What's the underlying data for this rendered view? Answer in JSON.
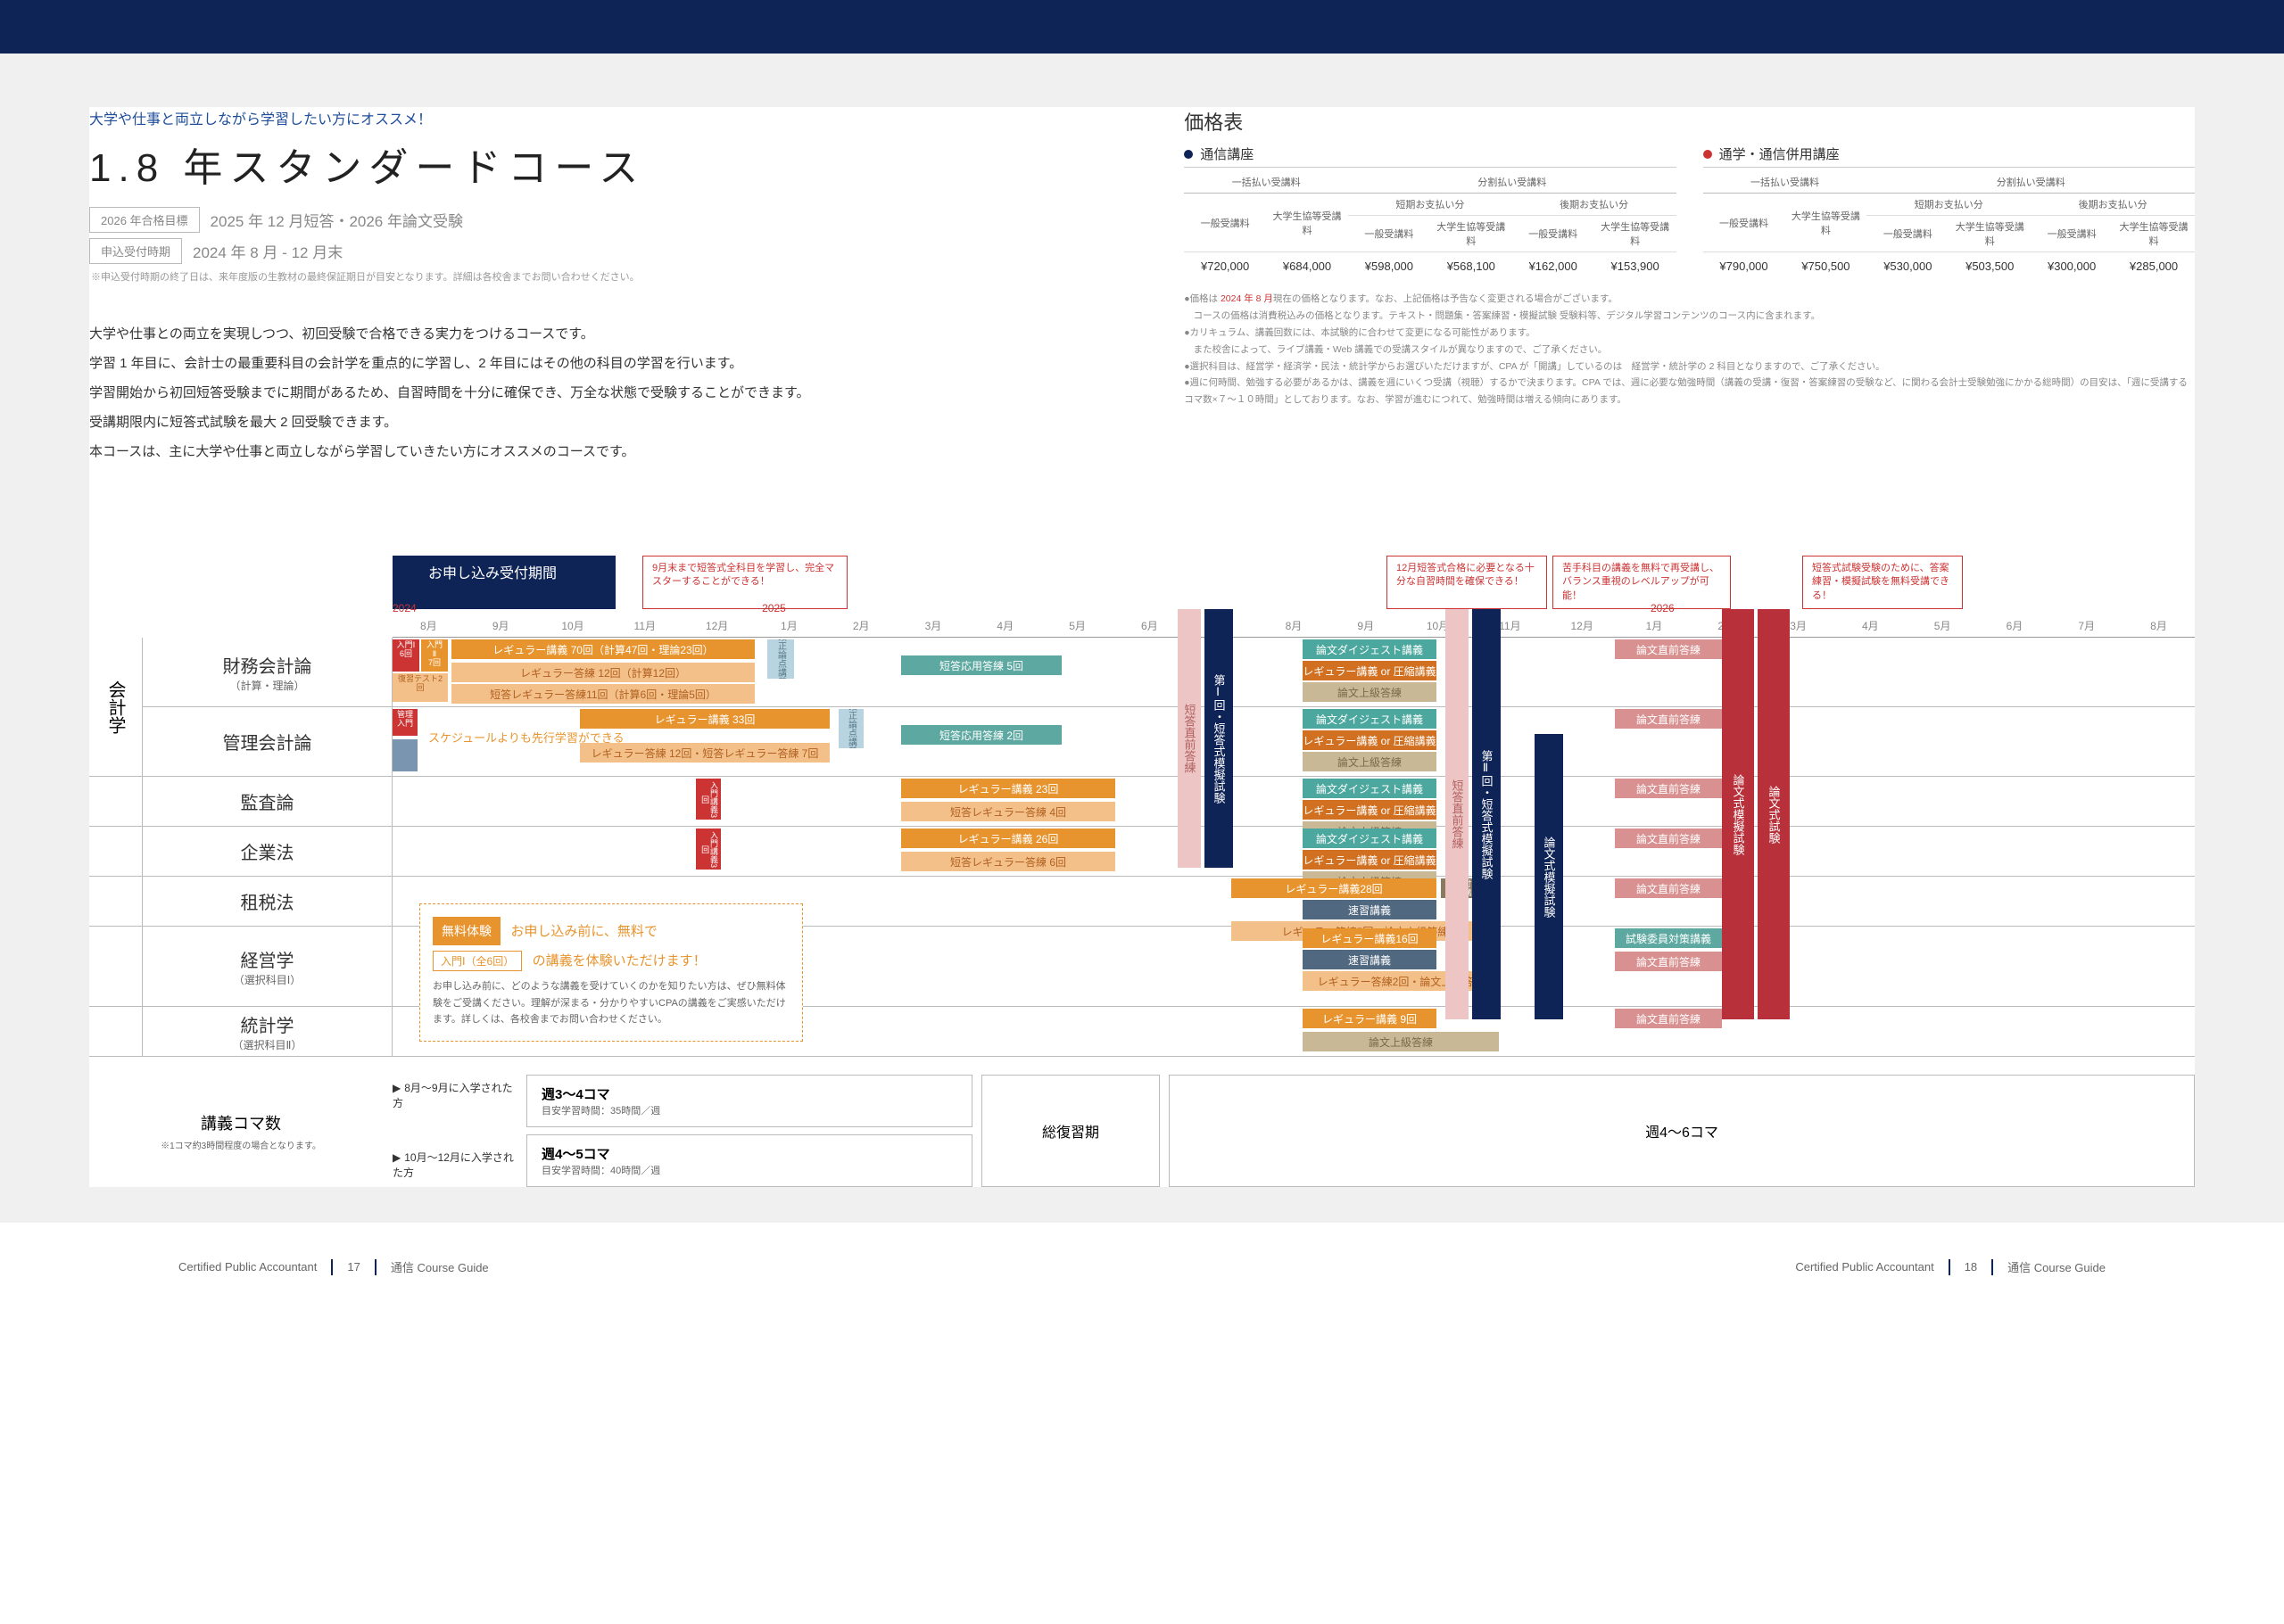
{
  "header": {
    "recommend": "大学や仕事と両立しながら学習したい方にオススメ！",
    "title": "1.8 年スタンダードコース",
    "tag1_label": "2026 年合格目標",
    "tag1_text": "2025 年 12 月短答・2026 年論文受験",
    "tag2_label": "申込受付時期",
    "tag2_text": "2024 年 8 月 - 12 月末",
    "tag2_note": "※申込受付時期の終了日は、来年度版の生教材の最終保証期日が目安となります。詳細は各校舎までお問い合わせください。"
  },
  "description": {
    "line1": "大学や仕事との両立を実現しつつ、初回受験で合格できる実力をつけるコースです。",
    "line2": "学習 1 年目に、会計士の最重要科目の会計学を重点的に学習し、2 年目にはその他の科目の学習を行います。",
    "line3": "学習開始から初回短答受験までに期間があるため、自習時間を十分に確保でき、万全な状態で受験することができます。",
    "line4": "受講期限内に短答式試験を最大 2 回受験できます。",
    "line5": "本コースは、主に大学や仕事と両立しながら学習していきたい方にオススメのコースです。"
  },
  "price": {
    "title": "価格表",
    "group1_title": "通信講座",
    "group2_title": "通学・通信併用講座",
    "col_lump": "一括払い受講料",
    "col_short": "短期お支払い分",
    "col_late": "後期お支払い分",
    "col_split": "分割払い受講料",
    "sub_general": "一般受講料",
    "sub_student": "大学生協等受講料",
    "g1": {
      "lump_general": "¥720,000",
      "lump_student": "¥684,000",
      "short_general": "¥598,000",
      "short_student": "¥568,100",
      "late_general": "¥162,000",
      "late_student": "¥153,900"
    },
    "g2": {
      "lump_general": "¥790,000",
      "lump_student": "¥750,500",
      "short_general": "¥530,000",
      "short_student": "¥503,500",
      "late_general": "¥300,000",
      "late_student": "¥285,000"
    },
    "notes": {
      "n1_pre": "●価格は ",
      "n1_hl": "2024 年 8 月",
      "n1_post": "現在の価格となります。なお、上記価格は予告なく変更される場合がございます。",
      "n2": "　コースの価格は消費税込みの価格となります。テキスト・問題集・答案練習・模擬試験 受験料等、デジタル学習コンテンツのコース内に含まれます。",
      "n3": "●カリキュラム、講義回数には、本試験的に合わせて変更になる可能性があります。",
      "n4": "　また校舎によって、ライブ講義・Web 講義での受講スタイルが異なりますので、ご了承ください。",
      "n5": "●選択科目は、経営学・経済学・民法・統計学からお選びいただけますが、CPA が「開講」しているのは　経営学・統計学の 2 科目となりますので、ご了承ください。",
      "n6": "●週に何時間、勉強する必要があるかは、講義を週にいくつ受講（視聴）するかで決まります。CPA では、週に必要な勉強時間（講義の受講・復習・答案練習の受験など、に関わる会計士受験勉強にかかる総時間）の目安は、「週に受講するコマ数×７～１０時間」としております。なお、学習が進むにつれて、勉強時間は増える傾向にあります。"
    }
  },
  "timeline": {
    "year1": "2024",
    "year2": "2025",
    "year3": "2026",
    "months": [
      "8月",
      "9月",
      "10月",
      "11月",
      "12月",
      "1月",
      "2月",
      "3月",
      "4月",
      "5月",
      "6月",
      "7月",
      "8月",
      "9月",
      "10月",
      "11月",
      "12月",
      "1月",
      "2月",
      "3月",
      "4月",
      "5月",
      "6月",
      "7月",
      "8月"
    ]
  },
  "callouts": {
    "apply": "お申し込み受付期間",
    "c1": "9月末まで短答式全科目を学習し、完全マスターすることができる！",
    "c2": "12月短答式合格に必要となる十分な自習時間を確保できる！",
    "c3": "苦手科目の講義を無料で再受講し、バランス重視のレベルアップが可能！",
    "c4": "短答式試験受験のために、答案練習・模擬試験を無料受講できる！"
  },
  "subjects": {
    "category": "会計学",
    "s1": "財務会計論",
    "s1_sub": "（計算・理論）",
    "s2": "管理会計論",
    "s3": "監査論",
    "s4": "企業法",
    "s5": "租税法",
    "s6": "経営学",
    "s6_sub": "（選択科目Ⅰ）",
    "s7": "統計学",
    "s7_sub": "（選択科目Ⅱ）"
  },
  "bars": {
    "intro1a": "入門Ⅰ",
    "intro1b": "6回",
    "intro2a": "入門Ⅱ",
    "intro2b": "7回",
    "test": "復習テスト2回",
    "reg70": "レギュラー講義 70回（計算47回・理論23回）",
    "reg12": "レギュラー答練 12回（計算12回）",
    "reg11": "短答レギュラー答練11回（計算6回・理論5回）",
    "kaisei": "改正論点講義",
    "tanou5": "短答応用答練 5回",
    "tanou2": "短答応用答練 2回",
    "digest": "論文ダイジェスト講義",
    "reg_or": "レギュラー講義 or 圧縮講義",
    "jokyu": "論文上級答練",
    "chokuzen": "論文直前答練",
    "mgmt_intro": "管理入門",
    "sched": "スケジュールよりも先行学習ができる",
    "reg33": "レギュラー講義 33回",
    "reg12b": "レギュラー答練 12回・短答レギュラー答練 7回",
    "nyumon": "入門講義3回",
    "reg23": "レギュラー講義 23回",
    "tanreg4": "短答レギュラー答練 4回",
    "reg26": "レギュラー講義 26回",
    "tanreg6": "短答レギュラー答練 6回",
    "reg28": "レギュラー講義28回",
    "sokushu": "速習講義",
    "reg5ron": "レギュラー答練5回・論文上級答練",
    "reg16": "レギュラー講義16回",
    "reg2ron": "レギュラー答練2回・論文上級答練",
    "reg9": "レギュラー講義 9回",
    "ronjokyu": "論文上級答練",
    "tanchoku": "短答直前答練",
    "moshi1": "第Ⅰ回・短答式模擬試験",
    "moshi2": "第Ⅱ回・短答式模擬試験",
    "ronmoshi": "論文式模擬試験",
    "ronshiken": "論文式試験",
    "shiken": "試験委員対策講義",
    "rironfuka": "理論付加対策講義"
  },
  "trial": {
    "badge": "無料体験",
    "title": "お申し込み前に、無料で",
    "tag": "入門Ⅰ（全6回）",
    "tag_after": "の講義を体験いただけます！",
    "body": "お申し込み前に、どのような講義を受けていくのかを知りたい方は、ぜひ無料体験をご受講ください。理解が深まる・分かりやすいCPAの講義をご実感いただけます。詳しくは、各校舎までお問い合わせください。"
  },
  "koma": {
    "label": "講義コマ数",
    "label_sub": "※1コマ約3時間程度の場合となります。",
    "e1_pre": "8月～9月に入学された方",
    "e1_title": "週3～4コマ",
    "e1_sub": "目安学習時間：35時間／週",
    "e2_pre": "10月～12月に入学された方",
    "e2_title": "週4～5コマ",
    "e2_sub": "目安学習時間：40時間／週",
    "review": "総復習期",
    "late": "週4～6コマ"
  },
  "footer": {
    "cert": "Certified Public Accountant",
    "p1": "17",
    "p2": "18",
    "guide": "通信 Course Guide"
  }
}
